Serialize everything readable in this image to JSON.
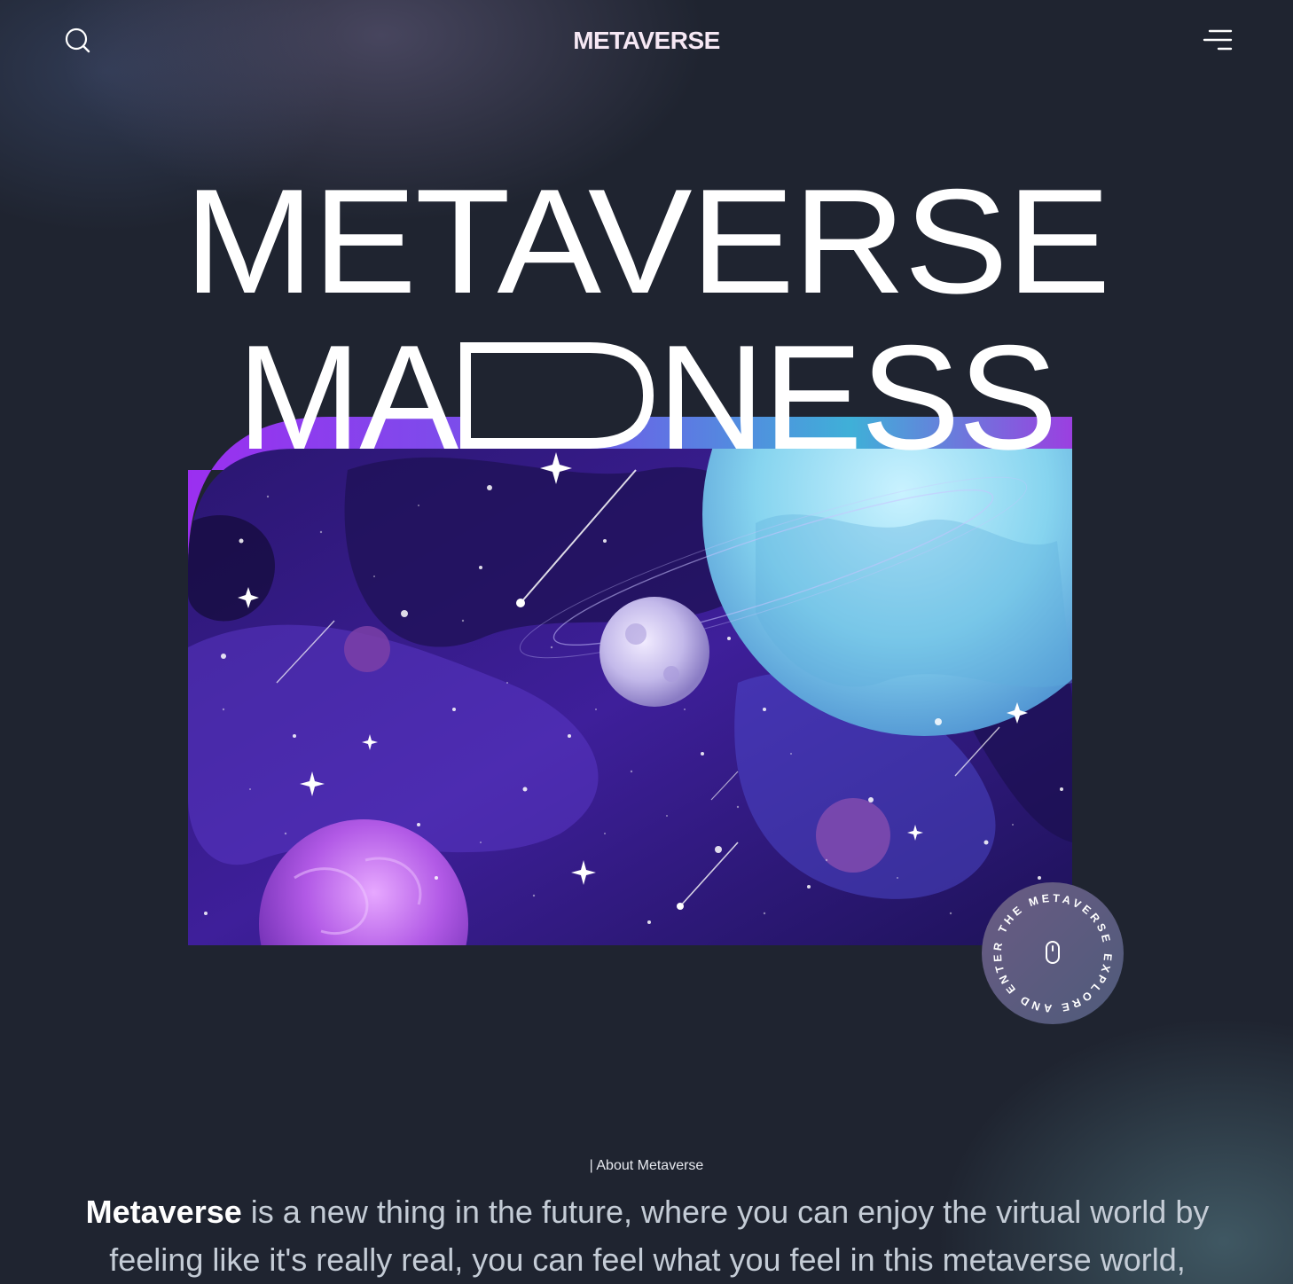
{
  "header": {
    "brand": "METAVERSE",
    "search_icon": "search-icon",
    "menu_icon": "menu-icon"
  },
  "hero": {
    "title_line1": "METAVERSE",
    "title_line2_left": "MA",
    "title_line2_right": "NESS"
  },
  "badge": {
    "text": "EXPLORE AND ENTER THE METAVERSE",
    "icon": "mouse-icon"
  },
  "about": {
    "label": "| About Metaverse",
    "highlight": "Metaverse",
    "text": " is a new thing in the future, where you can enjoy the virtual world by feeling like it's really real, you can feel what you feel in this metaverse world,"
  },
  "colors": {
    "background": "#1f2430",
    "accent_purple": "#8b2fe8",
    "accent_blue": "#3fb0d8",
    "badge_bg": "#5b5878"
  }
}
